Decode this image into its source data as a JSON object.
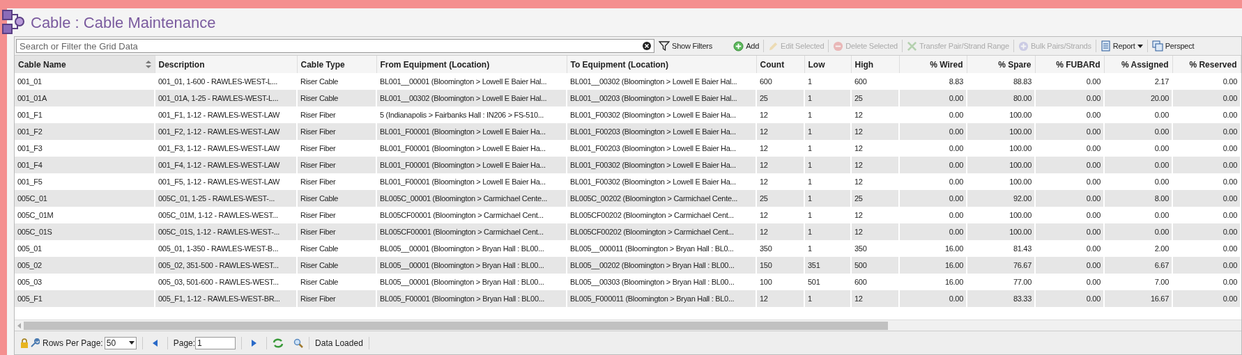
{
  "title": "Cable : Cable Maintenance",
  "search": {
    "placeholder": "Search or Filter the Grid Data"
  },
  "toolbar": [
    {
      "kind": "filter",
      "label": "Show Filters",
      "disabled": false
    },
    {
      "kind": "add",
      "label": "Add",
      "disabled": false
    },
    {
      "kind": "edit",
      "label": "Edit Selected",
      "disabled": true
    },
    {
      "kind": "delete",
      "label": "Delete Selected",
      "disabled": true
    },
    {
      "kind": "transfer",
      "label": "Transfer Pair/Strand Range",
      "disabled": true
    },
    {
      "kind": "bulk",
      "label": "Bulk Pairs/Strands",
      "disabled": true
    },
    {
      "kind": "report",
      "label": "Report",
      "disabled": false
    },
    {
      "kind": "perspective",
      "label": "Perspect",
      "disabled": false
    }
  ],
  "table": {
    "columns": [
      {
        "label": "Cable Name",
        "kind": "text",
        "sortable": true
      },
      {
        "label": "Description",
        "kind": "text",
        "sortable": false
      },
      {
        "label": "Cable Type",
        "kind": "text",
        "sortable": false
      },
      {
        "label": "From Equipment (Location)",
        "kind": "text",
        "sortable": false
      },
      {
        "label": "To Equipment (Location)",
        "kind": "text",
        "sortable": false
      },
      {
        "label": "Count",
        "kind": "text",
        "sortable": false
      },
      {
        "label": "Low",
        "kind": "text",
        "sortable": false
      },
      {
        "label": "High",
        "kind": "text",
        "sortable": false
      },
      {
        "label": "% Wired",
        "kind": "percent",
        "sortable": false
      },
      {
        "label": "% Spare",
        "kind": "percent",
        "sortable": false
      },
      {
        "label": "% FUBARd",
        "kind": "percent",
        "sortable": false
      },
      {
        "label": "% Assigned",
        "kind": "percent",
        "sortable": false
      },
      {
        "label": "% Reserved",
        "kind": "percent",
        "sortable": false
      }
    ],
    "rows": [
      [
        "001_01",
        "001_01, 1-600 - RAWLES-WEST-L...",
        "Riser Cable",
        "BL001__00001 (Bloomington > Lowell E Baier Hal...",
        "BL001__00302 (Bloomington > Lowell E Baier Hal...",
        "600",
        "1",
        "600",
        "8.83",
        "88.83",
        "0.00",
        "2.17",
        "0.00"
      ],
      [
        "001_01A",
        "001_01A, 1-25 - RAWLES-WEST-L...",
        "Riser Cable",
        "BL001__00302 (Bloomington > Lowell E Baier Hal...",
        "BL001__00203 (Bloomington > Lowell E Baier Hal...",
        "25",
        "1",
        "25",
        "0.00",
        "80.00",
        "0.00",
        "20.00",
        "0.00"
      ],
      [
        "001_F1",
        "001_F1, 1-12 - RAWLES-WEST-LAW",
        "Riser Fiber",
        "5 (Indianapolis > Fairbanks Hall : IN206 > FS-510...",
        "BL001_F00302 (Bloomington > Lowell E Baier Ha...",
        "12",
        "1",
        "12",
        "0.00",
        "100.00",
        "0.00",
        "0.00",
        "0.00"
      ],
      [
        "001_F2",
        "001_F2, 1-12 - RAWLES-WEST-LAW",
        "Riser Fiber",
        "BL001_F00001 (Bloomington > Lowell E Baier Ha...",
        "BL001_F00203 (Bloomington > Lowell E Baier Ha...",
        "12",
        "1",
        "12",
        "0.00",
        "100.00",
        "0.00",
        "0.00",
        "0.00"
      ],
      [
        "001_F3",
        "001_F3, 1-12 - RAWLES-WEST-LAW",
        "Riser Fiber",
        "BL001_F00001 (Bloomington > Lowell E Baier Ha...",
        "BL001_F00203 (Bloomington > Lowell E Baier Ha...",
        "12",
        "1",
        "12",
        "0.00",
        "100.00",
        "0.00",
        "0.00",
        "0.00"
      ],
      [
        "001_F4",
        "001_F4, 1-12 - RAWLES-WEST-LAW",
        "Riser Fiber",
        "BL001_F00001 (Bloomington > Lowell E Baier Ha...",
        "BL001_F00302 (Bloomington > Lowell E Baier Ha...",
        "12",
        "1",
        "12",
        "0.00",
        "100.00",
        "0.00",
        "0.00",
        "0.00"
      ],
      [
        "001_F5",
        "001_F5, 1-12 - RAWLES-WEST-LAW",
        "Riser Fiber",
        "BL001_F00001 (Bloomington > Lowell E Baier Ha...",
        "BL001_F00302 (Bloomington > Lowell E Baier Ha...",
        "12",
        "1",
        "12",
        "0.00",
        "100.00",
        "0.00",
        "0.00",
        "0.00"
      ],
      [
        "005C_01",
        "005C_01, 1-25 - RAWLES-WEST-...",
        "Riser Cable",
        "BL005C_00001 (Bloomington > Carmichael Cente...",
        "BL005C_00202 (Bloomington > Carmichael Cente...",
        "25",
        "1",
        "25",
        "0.00",
        "92.00",
        "0.00",
        "8.00",
        "0.00"
      ],
      [
        "005C_01M",
        "005C_01M, 1-12 - RAWLES-WEST...",
        "Riser Fiber",
        "BL005CF00001 (Bloomington > Carmichael Cent...",
        "BL005CF00202 (Bloomington > Carmichael Cent...",
        "12",
        "1",
        "12",
        "0.00",
        "100.00",
        "0.00",
        "0.00",
        "0.00"
      ],
      [
        "005C_01S",
        "005C_01S, 1-12 - RAWLES-WEST-...",
        "Riser Fiber",
        "BL005CF00001 (Bloomington > Carmichael Cent...",
        "BL005CF00202 (Bloomington > Carmichael Cent...",
        "12",
        "1",
        "12",
        "0.00",
        "100.00",
        "0.00",
        "0.00",
        "0.00"
      ],
      [
        "005_01",
        "005_01, 1-350 - RAWLES-WEST-B...",
        "Riser Cable",
        "BL005__00001 (Bloomington > Bryan Hall : BL00...",
        "BL005__000011 (Bloomington > Bryan Hall : BL0...",
        "350",
        "1",
        "350",
        "16.00",
        "81.43",
        "0.00",
        "2.00",
        "0.00"
      ],
      [
        "005_02",
        "005_02, 351-500 - RAWLES-WEST...",
        "Riser Cable",
        "BL005__00001 (Bloomington > Bryan Hall : BL00...",
        "BL005__00202 (Bloomington > Bryan Hall : BL00...",
        "150",
        "351",
        "500",
        "16.00",
        "76.67",
        "0.00",
        "6.67",
        "0.00"
      ],
      [
        "005_03",
        "005_03, 501-600 - RAWLES-WEST...",
        "Riser Cable",
        "BL005__00001 (Bloomington > Bryan Hall : BL00...",
        "BL005__00303 (Bloomington > Bryan Hall : BL00...",
        "100",
        "501",
        "600",
        "16.00",
        "77.00",
        "0.00",
        "7.00",
        "0.00"
      ],
      [
        "005_F1",
        "005_F1, 1-12 - RAWLES-WEST-BR...",
        "Riser Fiber",
        "BL005_F00001 (Bloomington > Bryan Hall : BL00...",
        "BL005_F000011 (Bloomington > Bryan Hall : BL0...",
        "12",
        "1",
        "12",
        "0.00",
        "83.33",
        "0.00",
        "16.67",
        "0.00"
      ]
    ]
  },
  "footer": {
    "rows_per_page_label": "Rows Per Page:",
    "rows_per_page": "50",
    "page_label": "Page:",
    "page": "1",
    "status": "Data Loaded"
  }
}
